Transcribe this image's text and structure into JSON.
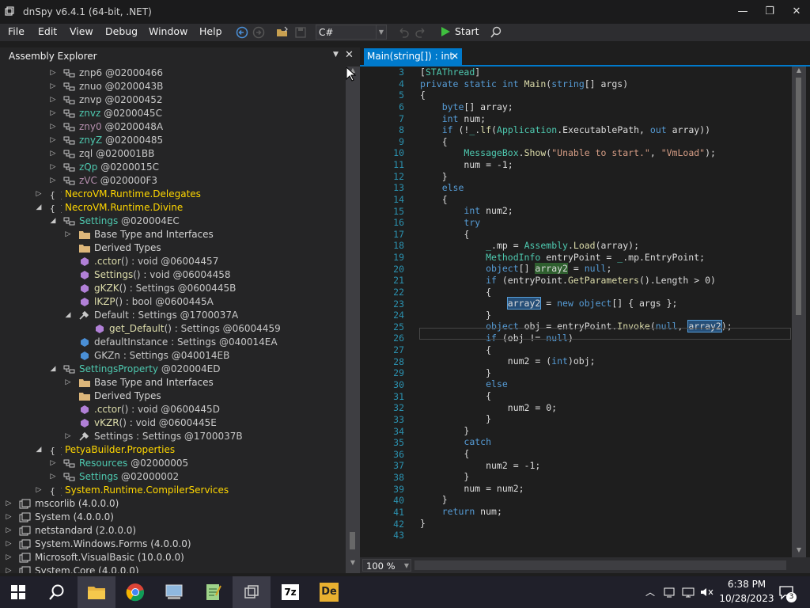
{
  "window": {
    "title": "dnSpy v6.4.1 (64-bit, .NET)",
    "minimize": "—",
    "maximize": "❐",
    "close": "✕"
  },
  "menu": [
    "File",
    "Edit",
    "View",
    "Debug",
    "Window",
    "Help"
  ],
  "toolbar": {
    "language": "C#",
    "start_label": "Start"
  },
  "explorer": {
    "title": "Assembly Explorer",
    "nodes": [
      {
        "label": "znp6",
        "suffix": " @02000466",
        "icon": "class-icon",
        "kind": "type",
        "indent": 0
      },
      {
        "label": "znuo",
        "suffix": " @0200043B",
        "icon": "class-icon",
        "kind": "type",
        "indent": 0
      },
      {
        "label": "znvp",
        "suffix": " @02000452",
        "icon": "class-icon",
        "kind": "type",
        "indent": 0
      },
      {
        "label": "znvz",
        "suffix": " @0200045C",
        "icon": "class-icon",
        "kind": "class",
        "indent": 0
      },
      {
        "label": "zny0",
        "suffix": " @0200048A",
        "icon": "class-icon",
        "kind": "gen",
        "indent": 0
      },
      {
        "label": "znyZ",
        "suffix": " @02000485",
        "icon": "class-icon",
        "kind": "class",
        "indent": 0
      },
      {
        "label": "zql",
        "suffix": " @020001BB",
        "icon": "class-icon",
        "kind": "type",
        "indent": 0
      },
      {
        "label": "zQp",
        "suffix": " @0200015C",
        "icon": "class-icon",
        "kind": "class",
        "indent": 0
      },
      {
        "label": "zVC",
        "suffix": " @020000F3",
        "icon": "class-icon",
        "kind": "gen",
        "indent": 0
      },
      {
        "label": "NecroVM.Runtime.Delegates",
        "suffix": "",
        "icon": "namespace-icon",
        "kind": "ns",
        "indent": -1
      },
      {
        "label": "NecroVM.Runtime.Divine",
        "suffix": "",
        "icon": "namespace-icon",
        "kind": "ns",
        "indent": -1
      },
      {
        "label": "Settings",
        "suffix": " @020004EC",
        "icon": "class-icon",
        "kind": "class",
        "indent": 0
      },
      {
        "label": "Base Type and Interfaces",
        "suffix": "",
        "icon": "folder-icon",
        "kind": "def",
        "indent": 1
      },
      {
        "label": "Derived Types",
        "suffix": "",
        "icon": "folder-icon",
        "kind": "def",
        "indent": 1
      },
      {
        "label": ".cctor",
        "suffix": "() : void @06004457",
        "icon": "method-icon",
        "kind": "meth",
        "indent": 1
      },
      {
        "label": "Settings",
        "suffix": "() : void @06004458",
        "icon": "method-icon",
        "kind": "meth",
        "indent": 1
      },
      {
        "label": "gKZK",
        "suffix": "() : Settings @0600445B",
        "icon": "method-icon",
        "kind": "meth",
        "indent": 1
      },
      {
        "label": "lKZP",
        "suffix": "() : bool @0600445A",
        "icon": "method-icon",
        "kind": "meth",
        "indent": 1
      },
      {
        "label": "Default",
        "suffix": " : Settings @1700037A",
        "icon": "property-icon",
        "kind": "prop",
        "indent": 1
      },
      {
        "label": "get_Default",
        "suffix": "() : Settings @06004459",
        "icon": "method-icon",
        "kind": "meth",
        "indent": 2
      },
      {
        "label": "defaultInstance",
        "suffix": " : Settings @040014EA",
        "icon": "field-icon",
        "kind": "prop",
        "indent": 1
      },
      {
        "label": "GKZn",
        "suffix": " : Settings @040014EB",
        "icon": "field-icon",
        "kind": "prop",
        "indent": 1
      },
      {
        "label": "SettingsProperty",
        "suffix": " @020004ED",
        "icon": "class-icon",
        "kind": "class",
        "indent": 0
      },
      {
        "label": "Base Type and Interfaces",
        "suffix": "",
        "icon": "folder-icon",
        "kind": "def",
        "indent": 1
      },
      {
        "label": "Derived Types",
        "suffix": "",
        "icon": "folder-icon",
        "kind": "def",
        "indent": 1
      },
      {
        "label": ".cctor",
        "suffix": "() : void @0600445D",
        "icon": "method-icon",
        "kind": "meth",
        "indent": 1
      },
      {
        "label": "vKZR",
        "suffix": "() : void @0600445E",
        "icon": "method-icon",
        "kind": "meth",
        "indent": 1
      },
      {
        "label": "Settings",
        "suffix": " : Settings @1700037B",
        "icon": "property-icon",
        "kind": "prop",
        "indent": 1
      },
      {
        "label": "PetyaBuilder.Properties",
        "suffix": "",
        "icon": "namespace-icon",
        "kind": "ns",
        "indent": -1
      },
      {
        "label": "Resources",
        "suffix": " @02000005",
        "icon": "class-icon",
        "kind": "class",
        "indent": 0
      },
      {
        "label": "Settings",
        "suffix": " @02000002",
        "icon": "class-icon",
        "kind": "class",
        "indent": 0
      },
      {
        "label": "System.Runtime.CompilerServices",
        "suffix": "",
        "icon": "namespace-icon",
        "kind": "ns",
        "indent": -1
      },
      {
        "label": "mscorlib",
        "suffix": " (4.0.0.0)",
        "icon": "assembly-icon",
        "kind": "asm",
        "indent": -3
      },
      {
        "label": "System",
        "suffix": " (4.0.0.0)",
        "icon": "assembly-icon",
        "kind": "asm",
        "indent": -3
      },
      {
        "label": "netstandard",
        "suffix": " (2.0.0.0)",
        "icon": "assembly-icon",
        "kind": "asm",
        "indent": -3
      },
      {
        "label": "System.Windows.Forms",
        "suffix": " (4.0.0.0)",
        "icon": "assembly-icon",
        "kind": "asm",
        "indent": -3
      },
      {
        "label": "Microsoft.VisualBasic",
        "suffix": " (10.0.0.0)",
        "icon": "assembly-icon",
        "kind": "asm",
        "indent": -3
      },
      {
        "label": "System.Core",
        "suffix": " (4.0.0.0)",
        "icon": "assembly-icon",
        "kind": "asm",
        "indent": -3
      }
    ]
  },
  "editor": {
    "tab_label": "Main(string[]) : int",
    "zoom": "100 %",
    "line_numbers": [
      "3",
      "4",
      "5",
      "6",
      "7",
      "8",
      "9",
      "10",
      "11",
      "12",
      "13",
      "14",
      "15",
      "16",
      "17",
      "18",
      "19",
      "20",
      "21",
      "22",
      "23",
      "24",
      "25",
      "26",
      "27",
      "28",
      "29",
      "30",
      "31",
      "32",
      "33",
      "34",
      "35",
      "36",
      "37",
      "38",
      "39",
      "40",
      "41",
      "42",
      "43"
    ]
  },
  "taskbar": {
    "time": "6:38 PM",
    "date": "10/28/2023",
    "notifications": "3"
  }
}
